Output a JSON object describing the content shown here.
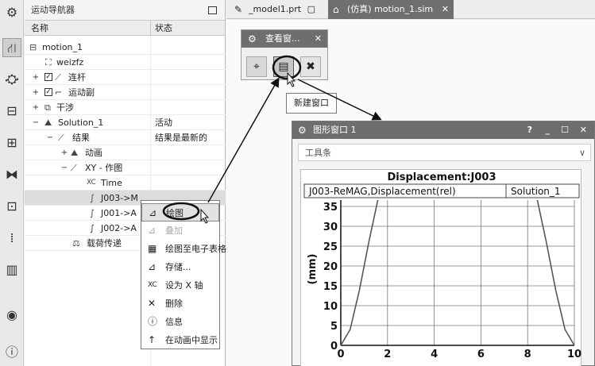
{
  "navigator": {
    "title": "运动导航器",
    "col_name": "名称",
    "col_status": "状态",
    "rows": [
      {
        "label": "motion_1",
        "status": ""
      },
      {
        "label": "weizfz",
        "status": ""
      },
      {
        "label": "连杆",
        "status": ""
      },
      {
        "label": "运动副",
        "status": ""
      },
      {
        "label": "干涉",
        "status": ""
      },
      {
        "label": "Solution_1",
        "status": "活动"
      },
      {
        "label": "结果",
        "status": "结果是最新的"
      },
      {
        "label": "动画",
        "status": ""
      },
      {
        "label": "XY - 作图",
        "status": ""
      },
      {
        "label": "Time",
        "status": ""
      },
      {
        "label": "J003->M",
        "status": ""
      },
      {
        "label": "J001->A",
        "status": ""
      },
      {
        "label": "J002->A",
        "status": ""
      },
      {
        "label": "载荷传递",
        "status": ""
      }
    ]
  },
  "tabs": [
    {
      "label": "_model1.prt",
      "icon": "part-file-icon"
    },
    {
      "label": "(仿真) motion_1.sim",
      "icon": "sim-file-icon"
    }
  ],
  "viewer": {
    "title": "查看窗...",
    "tooltip": "新建窗口"
  },
  "graph_window": {
    "title": "图形窗口 1",
    "help": "?",
    "toolbar_label": "工具条",
    "plot": {
      "title": "Displacement:J003",
      "legend_left": "J003-ReMAG,Displacement(rel)",
      "legend_right": "Solution_1",
      "ylabel": "(mm)"
    }
  },
  "context_menu": {
    "items": [
      {
        "label": "绘图",
        "icon": "plot-icon",
        "state": "highlighted"
      },
      {
        "label": "叠加",
        "icon": "overlay-icon",
        "state": "disabled"
      },
      {
        "label": "绘图至电子表格",
        "icon": "spreadsheet-icon",
        "state": "normal"
      },
      {
        "label": "存储...",
        "icon": "store-icon",
        "state": "normal"
      },
      {
        "label": "设为 X 轴",
        "icon": "x-axis-icon",
        "state": "normal"
      },
      {
        "label": "删除",
        "icon": "delete-icon",
        "state": "normal"
      },
      {
        "label": "信息",
        "icon": "info-icon",
        "state": "normal"
      },
      {
        "label": "在动画中显示",
        "icon": "animation-show-icon",
        "state": "normal"
      }
    ]
  },
  "chart_data": {
    "type": "line",
    "title": "Displacement:J003",
    "xlabel": "",
    "ylabel": "(mm)",
    "xlim": [
      0,
      10
    ],
    "ylim": [
      0,
      35
    ],
    "x_ticks": [
      0,
      2,
      4,
      6,
      8,
      10
    ],
    "y_ticks": [
      0,
      5,
      10,
      15,
      20,
      25,
      30,
      35
    ],
    "grid": true,
    "series": [
      {
        "name": "Solution_1",
        "x": [
          0,
          0.4,
          0.8,
          1.2,
          1.6,
          8.4,
          8.8,
          9.2,
          9.6,
          10
        ],
        "y": [
          0,
          4,
          14,
          26,
          37,
          37,
          26,
          14,
          4,
          0
        ]
      }
    ]
  }
}
